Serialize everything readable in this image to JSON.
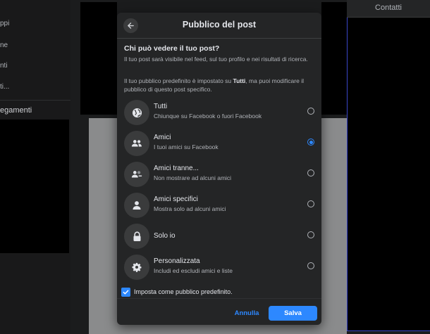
{
  "background": {
    "sidebar_items": [
      "ppi",
      "ne",
      "nti",
      "ti..."
    ],
    "section_title": "egamenti",
    "contacts_tab": "Contatti"
  },
  "dialog": {
    "title": "Pubblico del post",
    "question": "Chi può vedere il tuo post?",
    "description": "Il tuo post sarà visibile nel feed, sul tuo profilo e nei risultati di ricerca.",
    "default_note_prefix": "Il tuo pubblico predefinito è impostato su ",
    "default_note_value": "Tutti",
    "default_note_suffix": ", ma puoi modificare il pubblico di questo post specifico.",
    "options": [
      {
        "label": "Tutti",
        "sub": "Chiunque su Facebook o fuori Facebook",
        "icon": "globe-icon",
        "selected": false
      },
      {
        "label": "Amici",
        "sub": "I tuoi amici su Facebook",
        "icon": "friends-icon",
        "selected": true
      },
      {
        "label": "Amici tranne...",
        "sub": "Non mostrare ad alcuni amici",
        "icon": "friends-except-icon",
        "selected": false
      },
      {
        "label": "Amici specifici",
        "sub": "Mostra solo ad alcuni amici",
        "icon": "person-icon",
        "selected": false
      },
      {
        "label": "Solo io",
        "sub": "",
        "icon": "lock-icon",
        "selected": false
      },
      {
        "label": "Personalizzata",
        "sub": "Includi ed escludi amici e liste",
        "icon": "gear-icon",
        "selected": false
      }
    ],
    "set_default_label": "Imposta come pubblico predefinito.",
    "set_default_checked": true,
    "cancel_label": "Annulla",
    "save_label": "Salva"
  },
  "colors": {
    "accent": "#2d88ff",
    "dialog_bg": "#242526",
    "icon_bg": "#3a3b3c"
  }
}
